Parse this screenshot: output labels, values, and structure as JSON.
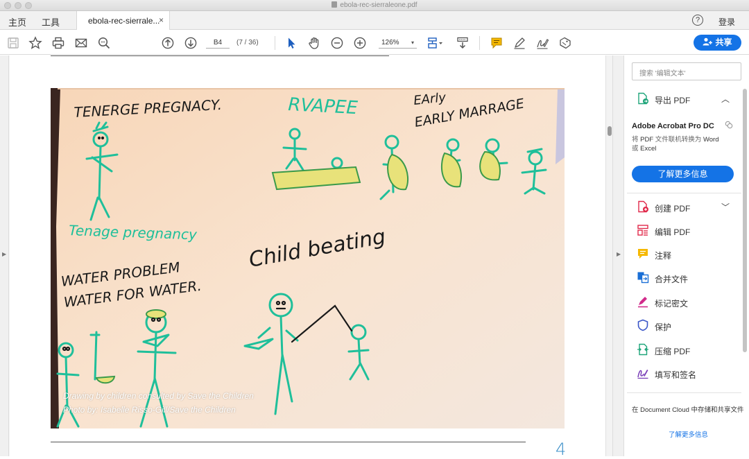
{
  "window": {
    "title": "ebola-rec-sierraleone.pdf"
  },
  "nav": {
    "home": "主页",
    "tools": "工具"
  },
  "tab": {
    "label": "ebola-rec-sierrale...",
    "close": "×"
  },
  "header": {
    "help": "?",
    "login": "登录"
  },
  "toolbar": {
    "page_current": "B4",
    "page_count": "(7 / 36)",
    "zoom": "126%",
    "zoom_caret": "▾",
    "share_label": "共享"
  },
  "document": {
    "caption_line1": "Drawing by children consulted by Save the Children",
    "caption_line2": "Photo by: Isabelle Risso-Gill/Save the Children",
    "page_number": "4",
    "drawing_texts": {
      "teen_pregnancy": "TENERGE PREGNACY.",
      "rape": "RVAPEE",
      "early_marriage_1": "EArly",
      "early_marriage_2": "EARLY MARRAGE",
      "teenage_pregnancy": "Tenage pregnancy",
      "child_beating": "Child beating",
      "water_problem_1": "WATER PROBLEM",
      "water_problem_2": "WATER FOR WATER."
    }
  },
  "pane": {
    "search_placeholder": "搜索 '编辑文本'",
    "export_pdf": "导出 PDF",
    "acrobat_title": "Adobe Acrobat Pro DC",
    "acrobat_desc_1": "将",
    "acrobat_desc_pdf": "PDF",
    "acrobat_desc_2": "文件联机转换为",
    "acrobat_desc_word": "Word",
    "acrobat_desc_3": "或",
    "acrobat_desc_excel": "Excel",
    "learn_more": "了解更多信息",
    "tools": [
      {
        "label": "创建 PDF",
        "icon": "create-pdf-icon",
        "color": "#e0294a"
      },
      {
        "label": "编辑 PDF",
        "icon": "edit-pdf-icon",
        "color": "#e0294a"
      },
      {
        "label": "注释",
        "icon": "comment-icon",
        "color": "#f5b800"
      },
      {
        "label": "合并文件",
        "icon": "combine-files-icon",
        "color": "#1a6fd6"
      },
      {
        "label": "标记密文",
        "icon": "redact-icon",
        "color": "#d12a8a"
      },
      {
        "label": "保护",
        "icon": "protect-icon",
        "color": "#3a56c8"
      },
      {
        "label": "压缩 PDF",
        "icon": "compress-pdf-icon",
        "color": "#1fa57a"
      },
      {
        "label": "填写和签名",
        "icon": "fill-sign-icon",
        "color": "#7a3fb8"
      }
    ],
    "cloud_text": "在 Document Cloud 中存储和共享文件",
    "cloud_link": "了解更多信息"
  },
  "colors": {
    "accent": "#1473e6"
  }
}
